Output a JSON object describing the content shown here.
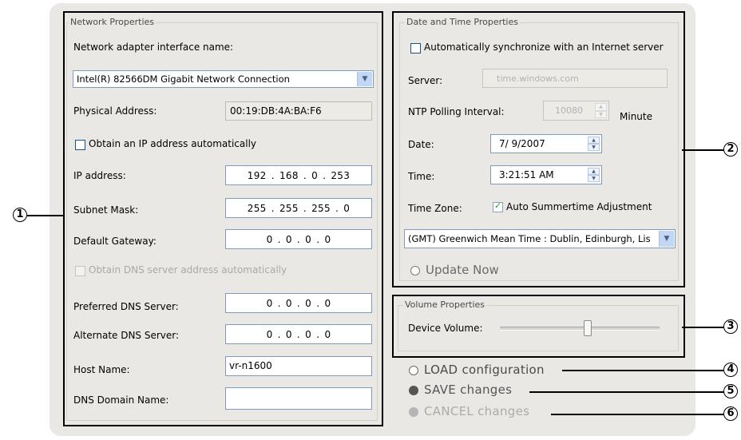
{
  "network": {
    "legend": "Network Properties",
    "adapter_label": "Network adapter interface name:",
    "adapter_value": "Intel(R) 82566DM Gigabit Network Connection",
    "physical_label": "Physical Address:",
    "physical_value": "00:19:DB:4A:BA:F6",
    "obtain_ip_label": "Obtain an IP address automatically",
    "obtain_ip_checked": false,
    "ip_label": "IP address:",
    "ip_value": "192 . 168 .  0  . 253",
    "subnet_label": "Subnet Mask:",
    "subnet_value": "255 . 255 . 255 .  0",
    "gateway_label": "Default Gateway:",
    "gateway_value": "0  .  0  .  0  .  0",
    "obtain_dns_label": "Obtain DNS server address automatically",
    "pref_dns_label": "Preferred DNS Server:",
    "pref_dns_value": "0  .  0  .  0  .  0",
    "alt_dns_label": "Alternate DNS Server:",
    "alt_dns_value": "0  .  0  .  0  .  0",
    "host_label": "Host Name:",
    "host_value": "vr-n1600",
    "domain_label": "DNS Domain Name:",
    "domain_value": ""
  },
  "datetime": {
    "legend": "Date and Time Properties",
    "auto_sync_label": "Automatically synchronize with an Internet server",
    "auto_sync_checked": false,
    "server_label": "Server:",
    "server_value": "time.windows.com",
    "ntp_label": "NTP Polling Interval:",
    "ntp_value": "10080",
    "ntp_unit": "Minute",
    "date_label": "Date:",
    "date_value": "7/ 9/2007",
    "time_label": "Time:",
    "time_value": "3:21:51 AM",
    "tz_label": "Time Zone:",
    "summertime_label": "Auto Summertime Adjustment",
    "summertime_checked": true,
    "tz_value": "(GMT) Greenwich Mean Time : Dublin, Edinburgh, Lis",
    "update_now": "Update Now"
  },
  "volume": {
    "legend": "Volume Properties",
    "device_label": "Device Volume:",
    "level": 0.55
  },
  "actions": {
    "load": "LOAD configuration",
    "save": "SAVE changes",
    "cancel": "CANCEL changes"
  },
  "callouts": [
    "1",
    "2",
    "3",
    "4",
    "5",
    "6"
  ]
}
